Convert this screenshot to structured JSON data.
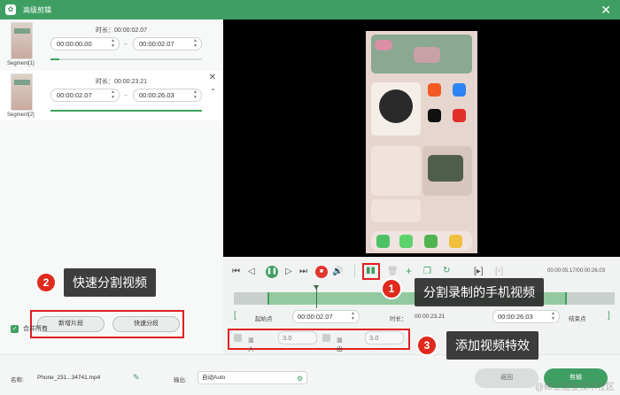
{
  "window": {
    "title": "高级剪辑"
  },
  "segments": [
    {
      "label": "Segment[1]",
      "duration_label": "时长：00:00:02.07",
      "start": "00:00:00.00",
      "end": "00:00:02.07"
    },
    {
      "label": "Segment[2]",
      "duration_label": "时长：00:00:23.21",
      "start": "00:00:02.07",
      "end": "00:00:26.03"
    }
  ],
  "left_actions": {
    "new_segment": "新增片段",
    "quick_split": "快速分段",
    "merge_all": "合并所有"
  },
  "player": {
    "time": "00:00:05.17/00:00:26.03"
  },
  "trim": {
    "start_point_label": "起始点",
    "start_value": "00:00:02.07",
    "duration_label": "时长：",
    "duration_value": "00:00:23.21",
    "end_value": "00:00:26.03",
    "end_point_label": "结束点"
  },
  "effects": {
    "fade_in_label": "淡入",
    "fade_in_value": "3.0",
    "fade_out_label": "淡出",
    "fade_out_value": "3.0"
  },
  "footer": {
    "name_label": "名称:",
    "name_value": "Phone_231...34741.mp4",
    "output_label": "输出:",
    "output_value": "自动Auto",
    "back_button": "返回",
    "save_button": "剪辑"
  },
  "annotations": {
    "step1_num": "1",
    "step1_text": "分割录制的手机视频",
    "step2_num": "2",
    "step2_text": "快速分割视频",
    "step3_num": "3",
    "step3_text": "添加视频特效"
  },
  "watermark": "@稀土掘金技术社区",
  "colors": {
    "brand_green": "#3f9f63",
    "accent_red": "#e02020",
    "track_green": "#93c99f"
  },
  "icons": [
    "app-logo-icon",
    "close-icon",
    "pencil-icon",
    "gear-icon",
    "play-icon",
    "stop-icon",
    "split-icon",
    "trash-icon",
    "add-icon",
    "copy-icon",
    "reset-icon",
    "volume-icon",
    "checkmark-icon"
  ]
}
